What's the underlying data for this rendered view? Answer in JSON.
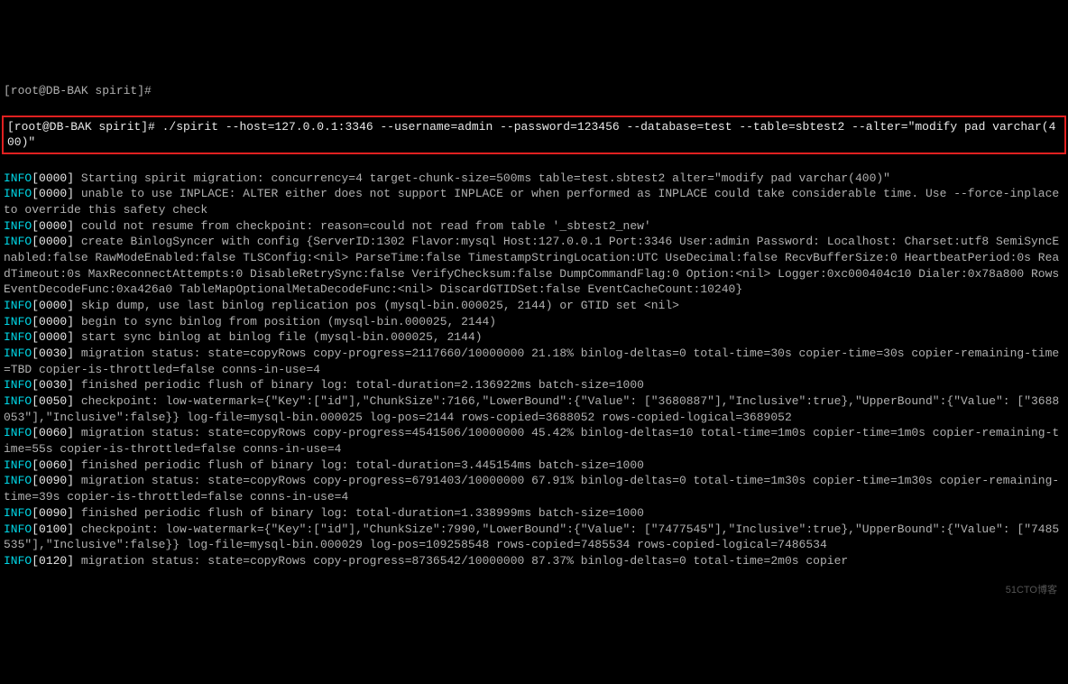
{
  "prompt_top": "[root@DB-BAK spirit]#",
  "command_line": "[root@DB-BAK spirit]# ./spirit --host=127.0.0.1:3346 --username=admin --password=123456 --database=test --table=sbtest2 --alter=\"modify pad varchar(400)\"",
  "lines": [
    {
      "prefix": "INFO",
      "time": "[0000]",
      "text": " Starting spirit migration: concurrency=4 target-chunk-size=500ms table=test.sbtest2 alter=\"modify pad varchar(400)\""
    },
    {
      "prefix": "INFO",
      "time": "[0000]",
      "text": " unable to use INPLACE: ALTER either does not support INPLACE or when performed as INPLACE could take considerable time. Use --force-inplace to override this safety check"
    },
    {
      "prefix": "INFO",
      "time": "[0000]",
      "text": " could not resume from checkpoint: reason=could not read from table '_sbtest2_new'"
    },
    {
      "prefix": "INFO",
      "time": "[0000]",
      "text": " create BinlogSyncer with config {ServerID:1302 Flavor:mysql Host:127.0.0.1 Port:3346 User:admin Password: Localhost: Charset:utf8 SemiSyncEnabled:false RawModeEnabled:false TLSConfig:<nil> ParseTime:false TimestampStringLocation:UTC UseDecimal:false RecvBufferSize:0 HeartbeatPeriod:0s ReadTimeout:0s MaxReconnectAttempts:0 DisableRetrySync:false VerifyChecksum:false DumpCommandFlag:0 Option:<nil> Logger:0xc000404c10 Dialer:0x78a800 RowsEventDecodeFunc:0xa426a0 TableMapOptionalMetaDecodeFunc:<nil> DiscardGTIDSet:false EventCacheCount:10240}"
    },
    {
      "prefix": "INFO",
      "time": "[0000]",
      "text": " skip dump, use last binlog replication pos (mysql-bin.000025, 2144) or GTID set <nil>"
    },
    {
      "prefix": "INFO",
      "time": "[0000]",
      "text": " begin to sync binlog from position (mysql-bin.000025, 2144)"
    },
    {
      "prefix": "INFO",
      "time": "[0000]",
      "text": " start sync binlog at binlog file (mysql-bin.000025, 2144)"
    },
    {
      "prefix": "INFO",
      "time": "[0030]",
      "text": " migration status: state=copyRows copy-progress=2117660/10000000 21.18% binlog-deltas=0 total-time=30s copier-time=30s copier-remaining-time=TBD copier-is-throttled=false conns-in-use=4"
    },
    {
      "prefix": "INFO",
      "time": "[0030]",
      "text": " finished periodic flush of binary log: total-duration=2.136922ms batch-size=1000"
    },
    {
      "prefix": "INFO",
      "time": "[0050]",
      "text": " checkpoint: low-watermark={\"Key\":[\"id\"],\"ChunkSize\":7166,\"LowerBound\":{\"Value\": [\"3680887\"],\"Inclusive\":true},\"UpperBound\":{\"Value\": [\"3688053\"],\"Inclusive\":false}} log-file=mysql-bin.000025 log-pos=2144 rows-copied=3688052 rows-copied-logical=3689052"
    },
    {
      "prefix": "INFO",
      "time": "[0060]",
      "text": " migration status: state=copyRows copy-progress=4541506/10000000 45.42% binlog-deltas=10 total-time=1m0s copier-time=1m0s copier-remaining-time=55s copier-is-throttled=false conns-in-use=4"
    },
    {
      "prefix": "INFO",
      "time": "[0060]",
      "text": " finished periodic flush of binary log: total-duration=3.445154ms batch-size=1000"
    },
    {
      "prefix": "INFO",
      "time": "[0090]",
      "text": " migration status: state=copyRows copy-progress=6791403/10000000 67.91% binlog-deltas=0 total-time=1m30s copier-time=1m30s copier-remaining-time=39s copier-is-throttled=false conns-in-use=4"
    },
    {
      "prefix": "INFO",
      "time": "[0090]",
      "text": " finished periodic flush of binary log: total-duration=1.338999ms batch-size=1000"
    },
    {
      "prefix": "INFO",
      "time": "[0100]",
      "text": " checkpoint: low-watermark={\"Key\":[\"id\"],\"ChunkSize\":7990,\"LowerBound\":{\"Value\": [\"7477545\"],\"Inclusive\":true},\"UpperBound\":{\"Value\": [\"7485535\"],\"Inclusive\":false}} log-file=mysql-bin.000029 log-pos=109258548 rows-copied=7485534 rows-copied-logical=7486534"
    },
    {
      "prefix": "INFO",
      "time": "[0120]",
      "text": " migration status: state=copyRows copy-progress=8736542/10000000 87.37% binlog-deltas=0 total-time=2m0s copier"
    }
  ],
  "watermark": "51CTO博客"
}
